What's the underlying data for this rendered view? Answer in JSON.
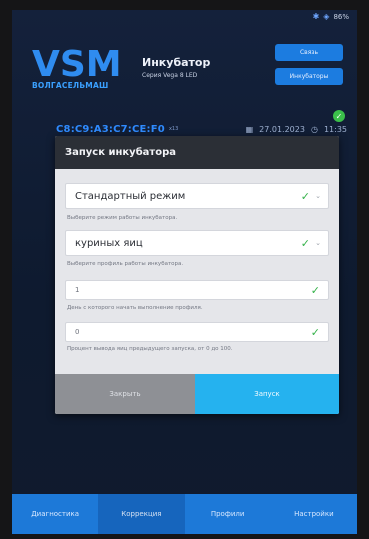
{
  "status": {
    "battery": "86%"
  },
  "brand": {
    "logo_text": "VSM",
    "logo_sub": "ВОЛГАСЕЛЬМАШ"
  },
  "header": {
    "title": "Инкубатор",
    "subtitle": "Серия Vega 8 LED",
    "btn_links": "Связь",
    "btn_incubators": "Инкубаторы"
  },
  "device": {
    "mac": "C8:C9:A3:C7:CE:F0",
    "signal": "x13",
    "date": "27.01.2023",
    "time": "11:35"
  },
  "dialog": {
    "title": "Запуск инкубатора",
    "mode_value": "Стандартный режим",
    "mode_hint": "Выберите режим работы инкубатора.",
    "profile_value": "куриных яиц",
    "profile_hint": "Выберите профиль работы инкубатора.",
    "day_value": "1",
    "day_hint": "День с которого начать выполнение профиля.",
    "pct_value": "0",
    "pct_hint": "Процент вывода яиц предыдущего запуска, от 0 до 100.",
    "close_label": "Закрыть",
    "start_label": "Запуск"
  },
  "tabs": [
    {
      "label": "Диагностика"
    },
    {
      "label": "Коррекция"
    },
    {
      "label": "Профили"
    },
    {
      "label": "Настройки"
    }
  ],
  "colors": {
    "accent": "#1c7ce0",
    "start": "#25b2ef",
    "check": "#35b24a"
  }
}
